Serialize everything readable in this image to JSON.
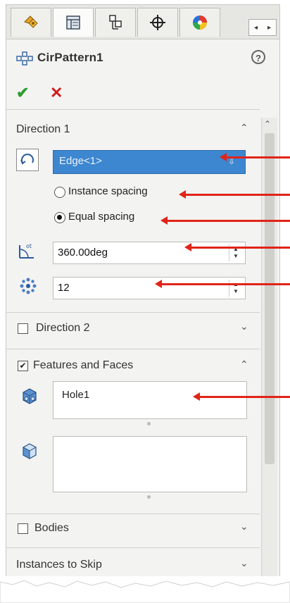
{
  "tabs": {
    "items": [
      {
        "name": "featuremanager-tab"
      },
      {
        "name": "propertymanager-tab"
      },
      {
        "name": "configurationmanager-tab"
      },
      {
        "name": "dimxpert-tab"
      },
      {
        "name": "display-manager-tab"
      }
    ],
    "scroll_left": "◂",
    "scroll_right": "▸"
  },
  "feature": {
    "title": "CirPattern1",
    "help_label": "?",
    "ok_label": "✔",
    "cancel_label": "✕"
  },
  "direction1": {
    "title": "Direction 1",
    "collapse_glyph": "⌃",
    "edge_value": "Edge<1>",
    "dropdown_glyph": "⇩",
    "instance_spacing_label": "Instance spacing",
    "equal_spacing_label": "Equal spacing",
    "selected_spacing": "Equal spacing",
    "angle_value": "360.00deg",
    "instances_value": "12"
  },
  "direction2": {
    "title": "Direction 2",
    "checked": false,
    "expand_glyph": "⌄"
  },
  "features_faces": {
    "title": "Features and Faces",
    "checked": true,
    "check_glyph": "✔",
    "collapse_glyph": "⌃",
    "features_list": [
      "Hole1"
    ],
    "faces_list": []
  },
  "bodies": {
    "title": "Bodies",
    "checked": false,
    "expand_glyph": "⌄"
  },
  "instances_to_skip": {
    "title": "Instances to Skip",
    "expand_glyph": "⌄"
  },
  "colors": {
    "accent_blue": "#3d86d0",
    "ok_green": "#2f9d2f",
    "cancel_red": "#d11c1c",
    "annotation_arrow": "#e02418"
  }
}
